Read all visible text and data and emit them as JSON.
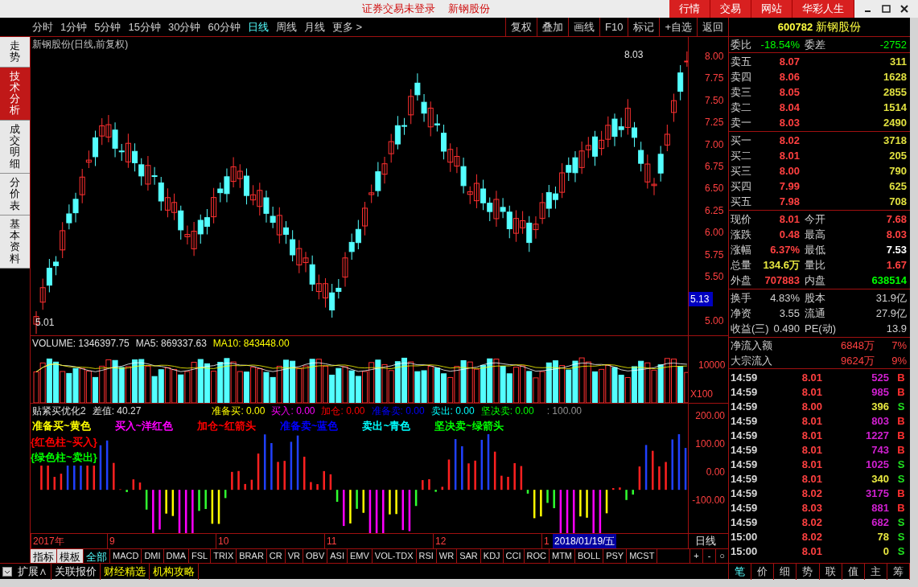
{
  "title_bar": {
    "status": "证券交易未登录",
    "stock": "新钢股份",
    "tabs": [
      "行情",
      "交易",
      "网站",
      "华彩人生"
    ]
  },
  "periods": [
    {
      "label": "分时",
      "selected": false
    },
    {
      "label": "1分钟",
      "selected": false
    },
    {
      "label": "5分钟",
      "selected": false
    },
    {
      "label": "15分钟",
      "selected": false
    },
    {
      "label": "30分钟",
      "selected": false
    },
    {
      "label": "60分钟",
      "selected": false
    },
    {
      "label": "日线",
      "selected": true
    },
    {
      "label": "周线",
      "selected": false
    },
    {
      "label": "月线",
      "selected": false
    },
    {
      "label": "更多 >",
      "selected": false
    }
  ],
  "tools": [
    "复权",
    "叠加",
    "画线",
    "F10",
    "标记",
    "+自选",
    "返回"
  ],
  "side_tabs": [
    {
      "label": "走势",
      "selected": false
    },
    {
      "label": "技术分析",
      "selected": true
    },
    {
      "label": "成交明细",
      "selected": false
    },
    {
      "label": "分价表",
      "selected": false
    },
    {
      "label": "基本资料",
      "selected": false
    }
  ],
  "chart": {
    "title": "新钢股份(日线,前复权)",
    "price_ticks": [
      "8.00",
      "7.75",
      "7.50",
      "7.25",
      "7.00",
      "6.75",
      "6.50",
      "6.25",
      "6.00",
      "5.75",
      "5.50"
    ],
    "bottom_tick": "5.00",
    "high_label": "8.03",
    "low_label": "5.01",
    "cursor_price": "5.13"
  },
  "volume": {
    "label": "VOLUME: 1346397.75",
    "ma5": "MA5: 869337.63",
    "ma10": "MA10: 843448.00",
    "tick": "10000",
    "unit": "X100"
  },
  "indicator": {
    "name": "贴紧买优化2",
    "diff": "差值: 40.27",
    "values": [
      {
        "label": "准备买:",
        "value": "0.00",
        "color": "#ffff00"
      },
      {
        "label": "买入:",
        "value": "0.00",
        "color": "#ff00ff"
      },
      {
        "label": "加仓:",
        "value": "0.00",
        "color": "#ff0000"
      },
      {
        "label": "准备卖:",
        "value": "0.00",
        "color": "#0000ff"
      },
      {
        "label": "卖出:",
        "value": "0.00",
        "color": "#00ffff"
      },
      {
        "label": "坚决卖:",
        "value": "0.00",
        "color": "#00ff00"
      }
    ],
    "extra": ": 100.00",
    "legend": [
      {
        "text": "准备买~黄色",
        "color": "#ffff00"
      },
      {
        "text": "买入~洋红色",
        "color": "#ff00ff"
      },
      {
        "text": "加仓~红箭头",
        "color": "#ff0000"
      },
      {
        "text": "准备卖~蓝色",
        "color": "#0000ff"
      },
      {
        "text": "卖出~青色",
        "color": "#00ffff"
      },
      {
        "text": "坚决卖~绿箭头",
        "color": "#00ff00"
      }
    ],
    "notes": [
      {
        "text": "{红色柱~买入}",
        "color": "#ff0000"
      },
      {
        "text": "{绿色柱~卖出}",
        "color": "#00ff00"
      }
    ],
    "ticks": [
      "200.00",
      "100.00",
      "0.00",
      "-100.00"
    ]
  },
  "dates": [
    "2017年",
    "9",
    "10",
    "11",
    "12",
    "1"
  ],
  "cursor_date": "2018/01/19/五",
  "period_label": "日线",
  "indicator_tabs": [
    {
      "label": "指标",
      "selected": false
    },
    {
      "label": "模板",
      "selected": false
    },
    {
      "label": "全部",
      "selected": true
    },
    {
      "label": "MACD",
      "selected": false
    },
    {
      "label": "DMI",
      "selected": false
    },
    {
      "label": "DMA",
      "selected": false
    },
    {
      "label": "FSL",
      "selected": false
    },
    {
      "label": "TRIX",
      "selected": false
    },
    {
      "label": "BRAR",
      "selected": false
    },
    {
      "label": "CR",
      "selected": false
    },
    {
      "label": "VR",
      "selected": false
    },
    {
      "label": "OBV",
      "selected": false
    },
    {
      "label": "ASI",
      "selected": false
    },
    {
      "label": "EMV",
      "selected": false
    },
    {
      "label": "VOL-TDX",
      "selected": false
    },
    {
      "label": "RSI",
      "selected": false
    },
    {
      "label": "WR",
      "selected": false
    },
    {
      "label": "SAR",
      "selected": false
    },
    {
      "label": "KDJ",
      "selected": false
    },
    {
      "label": "CCI",
      "selected": false
    },
    {
      "label": "ROC",
      "selected": false
    },
    {
      "label": "MTM",
      "selected": false
    },
    {
      "label": "BOLL",
      "selected": false
    },
    {
      "label": "PSY",
      "selected": false
    },
    {
      "label": "MCST",
      "selected": false
    }
  ],
  "zoom_buttons": [
    "+",
    "-",
    "○"
  ],
  "bottom_tabs": [
    {
      "label": "扩展∧",
      "highlighted": false
    },
    {
      "label": "关联报价",
      "highlighted": false
    },
    {
      "label": "财经精选",
      "highlighted": true
    },
    {
      "label": "机构攻略",
      "highlighted": true
    }
  ],
  "quote": {
    "code": "600782",
    "name": "新钢股份",
    "ratio": [
      {
        "label": "委比",
        "value": "-18.54%",
        "color": "#00ff00"
      },
      {
        "label": "委差",
        "value": "-2752",
        "color": "#00ff00"
      }
    ],
    "sells": [
      {
        "label": "卖五",
        "price": "8.07",
        "volume": "311"
      },
      {
        "label": "卖四",
        "price": "8.06",
        "volume": "1628"
      },
      {
        "label": "卖三",
        "price": "8.05",
        "volume": "2855"
      },
      {
        "label": "卖二",
        "price": "8.04",
        "volume": "1514"
      },
      {
        "label": "卖一",
        "price": "8.03",
        "volume": "2490"
      }
    ],
    "buys": [
      {
        "label": "买一",
        "price": "8.02",
        "volume": "3718"
      },
      {
        "label": "买二",
        "price": "8.01",
        "volume": "205"
      },
      {
        "label": "买三",
        "price": "8.00",
        "volume": "790"
      },
      {
        "label": "买四",
        "price": "7.99",
        "volume": "625"
      },
      {
        "label": "买五",
        "price": "7.98",
        "volume": "708"
      }
    ],
    "stats": [
      [
        {
          "label": "现价",
          "value": "8.01",
          "kind": "up"
        },
        {
          "label": "今开",
          "value": "7.68",
          "kind": "up"
        }
      ],
      [
        {
          "label": "涨跌",
          "value": "0.48",
          "kind": "up"
        },
        {
          "label": "最高",
          "value": "8.03",
          "kind": "up"
        }
      ],
      [
        {
          "label": "涨幅",
          "value": "6.37%",
          "kind": "up"
        },
        {
          "label": "最低",
          "value": "7.53",
          "kind": "flat"
        }
      ],
      [
        {
          "label": "总量",
          "value": "134.6万",
          "kind": "volume"
        },
        {
          "label": "量比",
          "value": "1.67",
          "kind": "up"
        }
      ],
      [
        {
          "label": "外盘",
          "value": "707883",
          "kind": "up"
        },
        {
          "label": "内盘",
          "value": "638514",
          "kind": "down"
        }
      ]
    ],
    "fundamentals": [
      [
        {
          "label": "换手",
          "value": "4.83%"
        },
        {
          "label": "股本",
          "value": "31.9亿"
        }
      ],
      [
        {
          "label": "净资",
          "value": "3.55"
        },
        {
          "label": "流通",
          "value": "27.9亿"
        }
      ],
      [
        {
          "label": "收益(三)",
          "value": "0.490"
        },
        {
          "label": "PE(动)",
          "value": "13.9"
        }
      ]
    ],
    "flows": [
      {
        "label": "净流入额",
        "amount": "6848万",
        "percent": "7%"
      },
      {
        "label": "大宗流入",
        "amount": "9624万",
        "percent": "9%"
      }
    ],
    "ticks": [
      {
        "time": "14:59",
        "price": "8.01",
        "volume": "525",
        "color": "#d020d0",
        "side": "B",
        "kind": "buy"
      },
      {
        "time": "14:59",
        "price": "8.01",
        "volume": "985",
        "color": "#d020d0",
        "side": "B",
        "kind": "buy"
      },
      {
        "time": "14:59",
        "price": "8.00",
        "volume": "396",
        "color": "#e8e840",
        "side": "S",
        "kind": "sell"
      },
      {
        "time": "14:59",
        "price": "8.01",
        "volume": "803",
        "color": "#d020d0",
        "side": "B",
        "kind": "buy"
      },
      {
        "time": "14:59",
        "price": "8.01",
        "volume": "1227",
        "color": "#d020d0",
        "side": "B",
        "kind": "buy"
      },
      {
        "time": "14:59",
        "price": "8.01",
        "volume": "743",
        "color": "#d020d0",
        "side": "B",
        "kind": "buy"
      },
      {
        "time": "14:59",
        "price": "8.01",
        "volume": "1025",
        "color": "#d020d0",
        "side": "S",
        "kind": "sell"
      },
      {
        "time": "14:59",
        "price": "8.01",
        "volume": "340",
        "color": "#e8e840",
        "side": "S",
        "kind": "sell"
      },
      {
        "time": "14:59",
        "price": "8.02",
        "volume": "3175",
        "color": "#d020d0",
        "side": "B",
        "kind": "buy"
      },
      {
        "time": "14:59",
        "price": "8.03",
        "volume": "881",
        "color": "#d020d0",
        "side": "B",
        "kind": "buy"
      },
      {
        "time": "14:59",
        "price": "8.02",
        "volume": "682",
        "color": "#d020d0",
        "side": "S",
        "kind": "sell"
      },
      {
        "time": "15:00",
        "price": "8.02",
        "volume": "78",
        "color": "#e8e840",
        "side": "S",
        "kind": "sell"
      },
      {
        "time": "15:00",
        "price": "8.01",
        "volume": "0",
        "color": "#e8e840",
        "side": "S",
        "kind": "sell"
      }
    ],
    "panel_tabs": [
      {
        "label": "笔",
        "selected": true
      },
      {
        "label": "价",
        "selected": false
      },
      {
        "label": "细",
        "selected": false
      },
      {
        "label": "势",
        "selected": false
      },
      {
        "label": "联",
        "selected": false
      },
      {
        "label": "值",
        "selected": false
      },
      {
        "label": "主",
        "selected": false
      },
      {
        "label": "筹",
        "selected": false
      }
    ]
  }
}
